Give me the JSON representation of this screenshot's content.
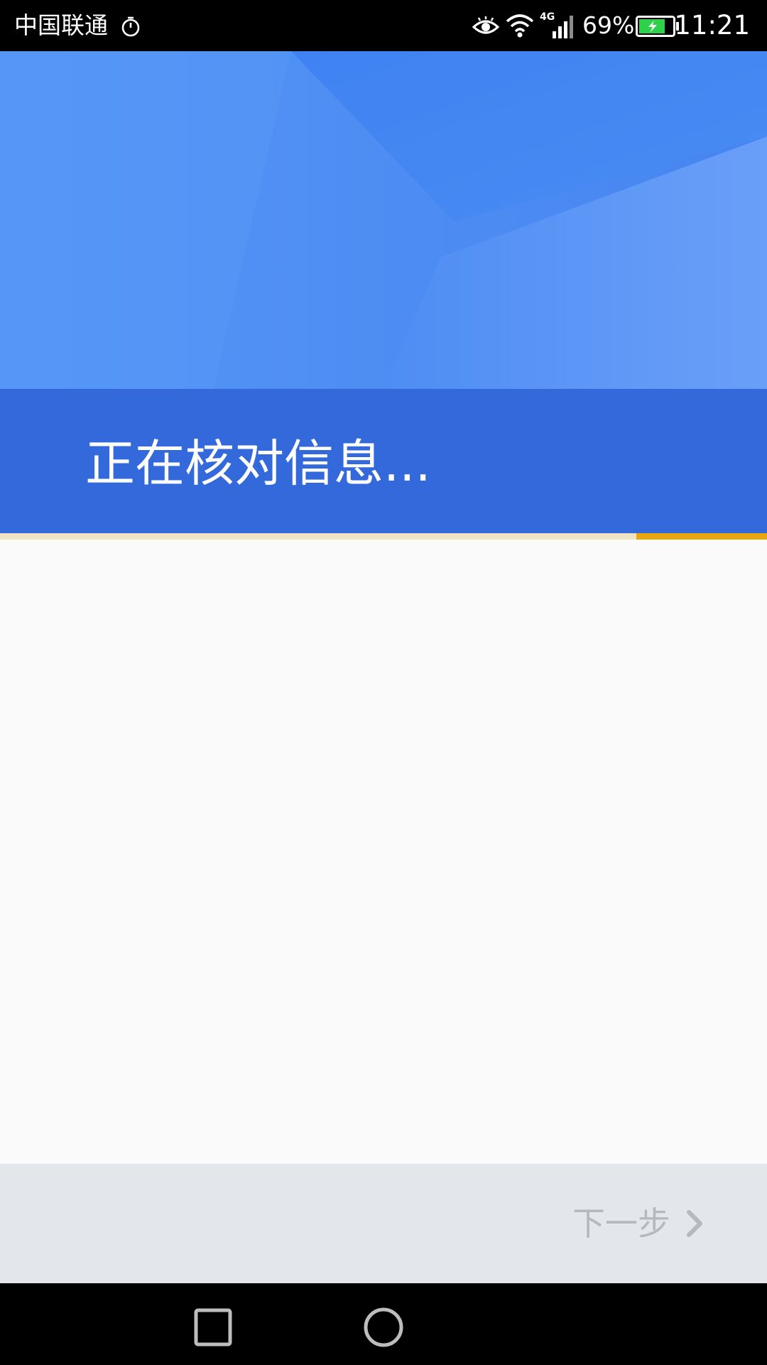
{
  "status_bar": {
    "carrier": "中国联通",
    "network_type": "4G",
    "battery_percent": "69%",
    "time": "11:21",
    "icons": [
      "timer-icon",
      "eye-icon",
      "wifi-icon",
      "signal-icon",
      "battery-charging-icon"
    ]
  },
  "header": {
    "title": "正在核对信息..."
  },
  "progress": {
    "fraction": 0.17
  },
  "action_bar": {
    "next_label": "下一步",
    "next_icon": "chevron-right-icon"
  },
  "nav_bar": {
    "icons": [
      "recents-icon",
      "home-icon"
    ]
  },
  "colors": {
    "header_blue": "#4a89f0",
    "header_band": "#3369db",
    "progress_accent": "#e8a90f",
    "battery_green": "#2fd04a",
    "disabled_text": "#b4b8bf"
  }
}
